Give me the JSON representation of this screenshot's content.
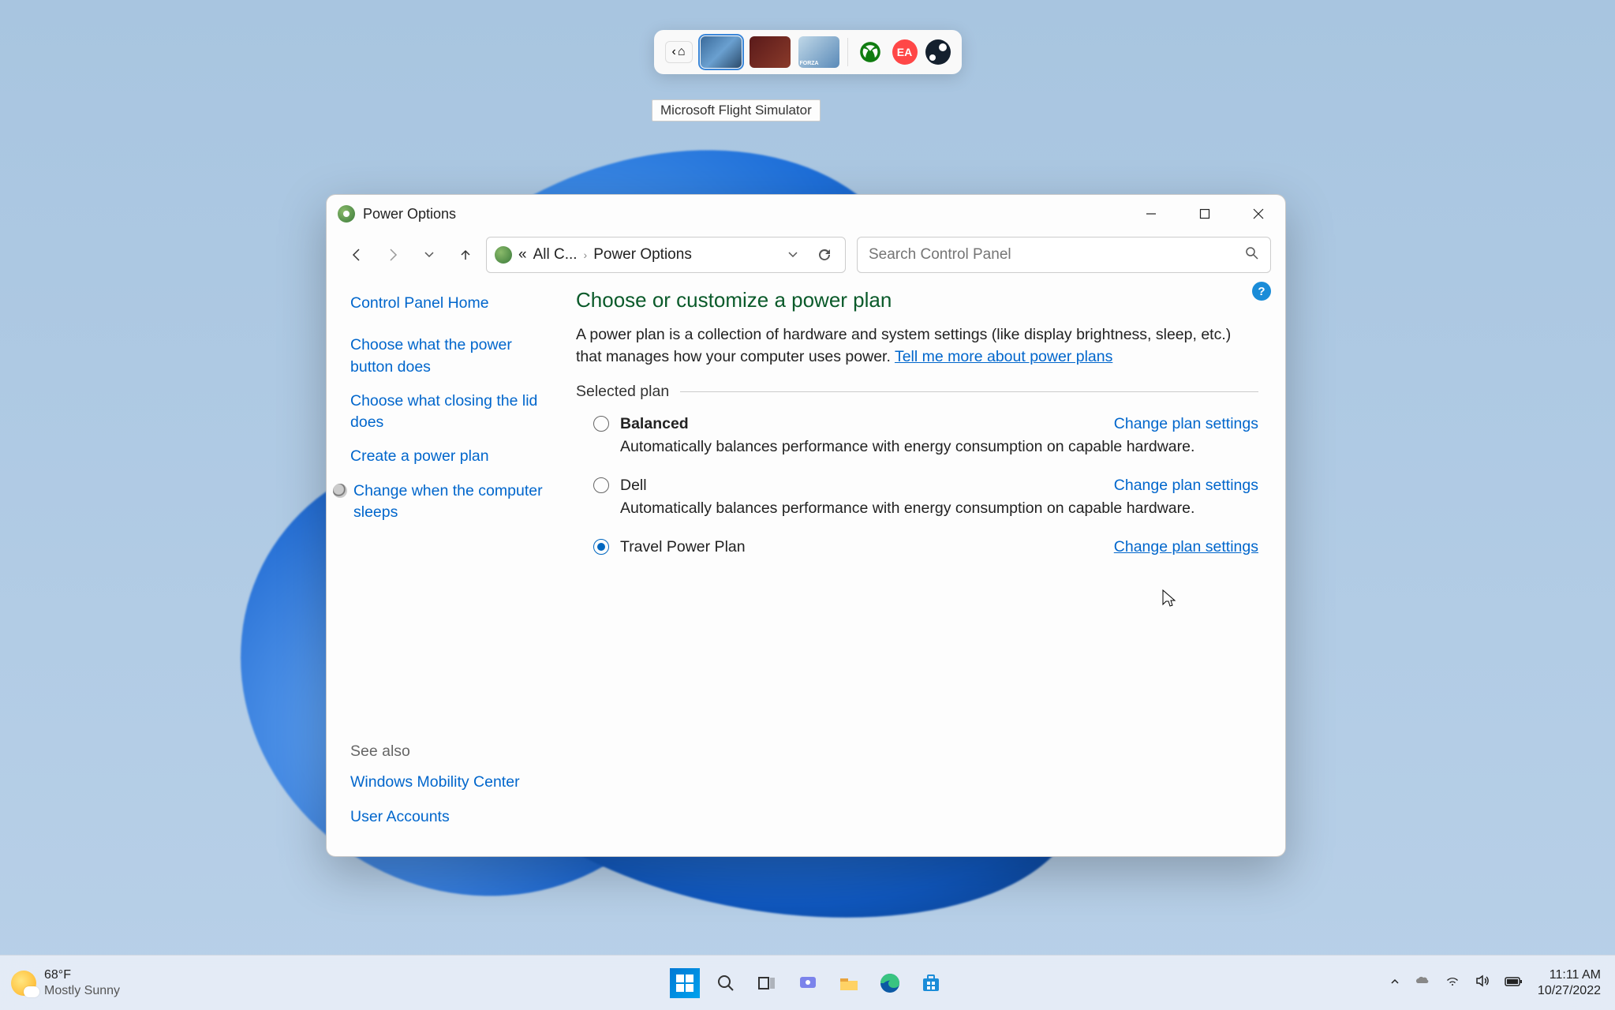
{
  "gamebar": {
    "tooltip": "Microsoft Flight Simulator"
  },
  "window": {
    "title": "Power Options",
    "breadcrumb": {
      "root": "«",
      "level1": "All C...",
      "level2": "Power Options"
    },
    "search_placeholder": "Search Control Panel"
  },
  "sidebar": {
    "home": "Control Panel Home",
    "links": [
      "Choose what the power button does",
      "Choose what closing the lid does",
      "Create a power plan",
      "Change when the computer sleeps"
    ],
    "see_also_heading": "See also",
    "see_also": [
      "Windows Mobility Center",
      "User Accounts"
    ]
  },
  "content": {
    "heading": "Choose or customize a power plan",
    "desc_pre": "A power plan is a collection of hardware and system settings (like display brightness, sleep, etc.) that manages how your computer uses power. ",
    "desc_link": "Tell me more about power plans",
    "group_label": "Selected plan",
    "change_link": "Change plan settings",
    "plans": [
      {
        "name": "Balanced",
        "bold": true,
        "desc": "Automatically balances performance with energy consumption on capable hardware.",
        "selected": false
      },
      {
        "name": "Dell",
        "bold": false,
        "desc": "Automatically balances performance with energy consumption on capable hardware.",
        "selected": false
      },
      {
        "name": "Travel Power Plan",
        "bold": false,
        "desc": "",
        "selected": true
      }
    ]
  },
  "taskbar": {
    "temp": "68°F",
    "cond": "Mostly Sunny",
    "time": "11:11 AM",
    "date": "10/27/2022"
  }
}
